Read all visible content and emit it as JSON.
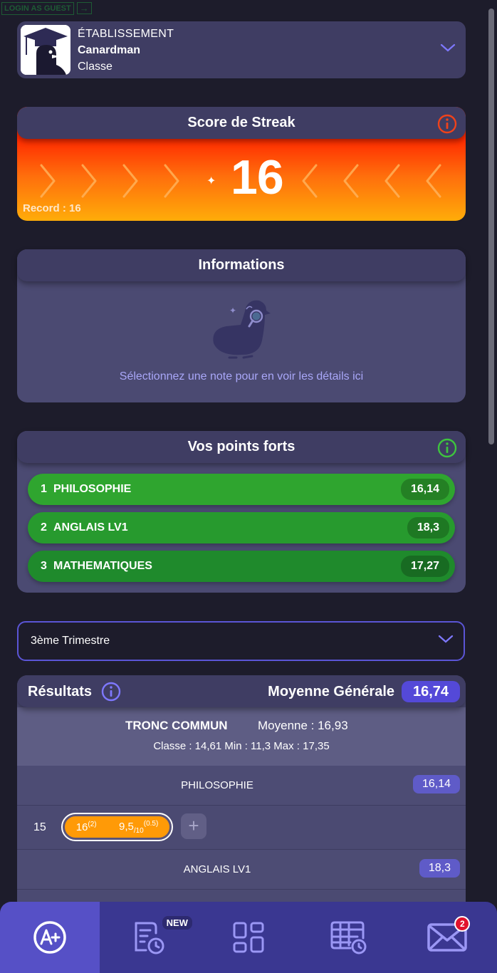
{
  "guest": {
    "label": "LOGIN AS GUEST",
    "arrow": "→"
  },
  "school": {
    "type": "ÉTABLISSEMENT",
    "name": "Canardman",
    "class": "Classe"
  },
  "streak": {
    "title": "Score de Streak",
    "value": "16",
    "record": "Record : 16"
  },
  "infos": {
    "title": "Informations",
    "empty_text": "Sélectionnez une note pour en voir les détails ici"
  },
  "strengths": {
    "title": "Vos points forts",
    "items": [
      {
        "rank": "1",
        "subject": "PHILOSOPHIE",
        "score": "16,14"
      },
      {
        "rank": "2",
        "subject": "ANGLAIS LV1",
        "score": "18,3"
      },
      {
        "rank": "3",
        "subject": "MATHEMATIQUES",
        "score": "17,27"
      }
    ]
  },
  "period": {
    "selected": "3ème Trimestre"
  },
  "results": {
    "title": "Résultats",
    "general_label": "Moyenne Générale",
    "general_value": "16,74",
    "group": {
      "title": "TRONC COMMUN",
      "average": "Moyenne : 16,93",
      "stats": "Classe : 14,61   Min : 11,3   Max : 17,35"
    },
    "subjects": [
      {
        "name": "PHILOSOPHIE",
        "score": "16,14"
      },
      {
        "name": "ANGLAIS LV1",
        "score": "18,3"
      }
    ],
    "grades": {
      "average": "15",
      "g1_value": "16",
      "g1_coef": "(2)",
      "g2_value": "9,5",
      "g2_scale": "/10",
      "g2_coef": "(0.5)",
      "add": "+"
    }
  },
  "nav": {
    "new_badge": "NEW",
    "messages_count": "2"
  },
  "colors": {
    "accent": "#5449d8",
    "background": "#1d1c2b",
    "card": "#4b4a72",
    "green": "#2fa52f"
  }
}
